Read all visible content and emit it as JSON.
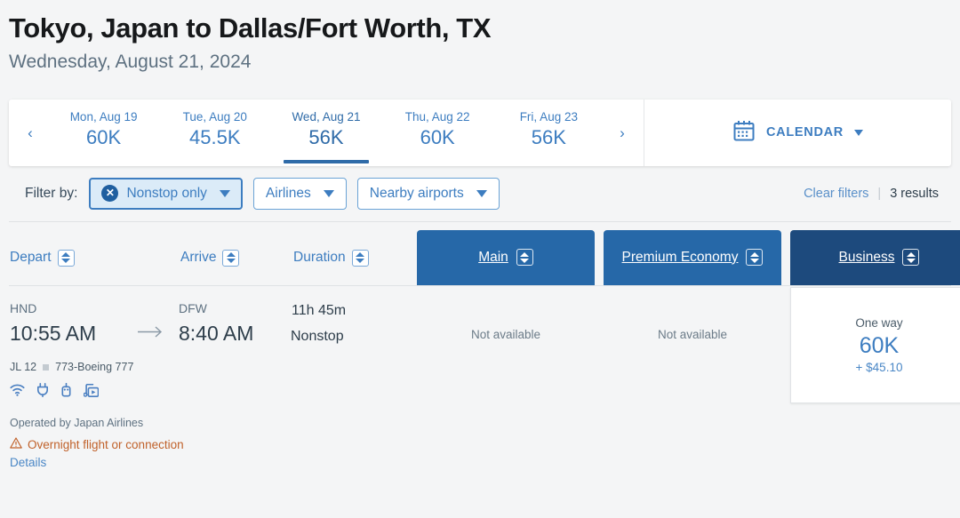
{
  "header": {
    "route_title": "Tokyo, Japan to Dallas/Fort Worth, TX",
    "date_subtitle": "Wednesday, August 21, 2024"
  },
  "carousel": {
    "prev_arrow": "‹",
    "next_arrow": "›",
    "dates": [
      {
        "label": "Mon, Aug 19",
        "price": "60K",
        "selected": false
      },
      {
        "label": "Tue, Aug 20",
        "price": "45.5K",
        "selected": false
      },
      {
        "label": "Wed, Aug 21",
        "price": "56K",
        "selected": true
      },
      {
        "label": "Thu, Aug 22",
        "price": "60K",
        "selected": false
      },
      {
        "label": "Fri, Aug 23",
        "price": "56K",
        "selected": false
      }
    ],
    "calendar_label": "CALENDAR",
    "calendar_icon": "calendar-icon",
    "calendar_caret_icon": "chevron-down-icon"
  },
  "filters": {
    "label": "Filter by:",
    "chips": [
      {
        "label": "Nonstop only",
        "active": true,
        "remove_icon": "close-circle-icon",
        "caret_icon": "chevron-down-icon"
      },
      {
        "label": "Airlines",
        "active": false,
        "caret_icon": "chevron-down-icon"
      },
      {
        "label": "Nearby airports",
        "active": false,
        "caret_icon": "chevron-down-icon"
      }
    ],
    "clear_filters": "Clear filters",
    "separator": "|",
    "results_count": "3 results"
  },
  "columns": {
    "depart": "Depart",
    "arrive": "Arrive",
    "duration": "Duration",
    "sort_icon": "sort-updown-icon"
  },
  "cabins": [
    {
      "label": "Main",
      "style": "main"
    },
    {
      "label": "Premium Economy",
      "style": "prem"
    },
    {
      "label": "Business",
      "style": "biz"
    }
  ],
  "flight": {
    "depart_airport": "HND",
    "depart_time": "10:55 AM",
    "arrow_icon": "arrow-right-icon",
    "arrive_airport": "DFW",
    "arrive_time": "8:40 AM",
    "duration": "11h 45m",
    "stops": "Nonstop",
    "flight_number": "JL 12",
    "aircraft": "773-Boeing 777",
    "amenities": [
      "wifi-icon",
      "power-outlet-icon",
      "usb-port-icon",
      "entertainment-icon"
    ],
    "operated_by": "Operated by Japan Airlines",
    "warning_icon": "warning-triangle-icon",
    "warning_text": "Overnight flight or connection",
    "details_link": "Details",
    "fares": [
      {
        "type": "unavailable",
        "text": "Not available"
      },
      {
        "type": "unavailable",
        "text": "Not available"
      },
      {
        "type": "price",
        "trip_type": "One way",
        "miles": "60K",
        "cash": "+ $45.10"
      }
    ]
  },
  "colors": {
    "accent_blue": "#3d7dc0",
    "tab_blue": "#2668a8",
    "tab_navy": "#1d4a7d",
    "warning_orange": "#c0612a",
    "page_bg": "#f4f5f6"
  }
}
